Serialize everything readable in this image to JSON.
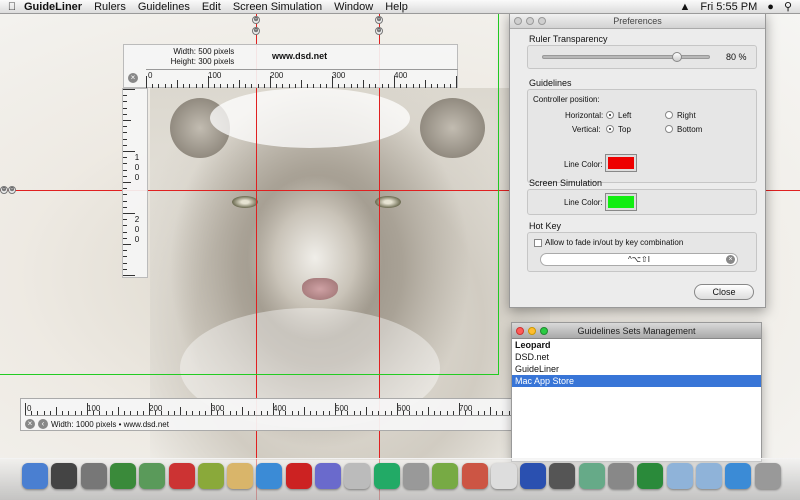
{
  "menubar": {
    "apple": "",
    "app_name": "GuideLiner",
    "items": [
      "Rulers",
      "Guidelines",
      "Edit",
      "Screen Simulation",
      "Window",
      "Help"
    ],
    "clock": "Fri 5:55 PM"
  },
  "top_ruler": {
    "width_label": "Width:",
    "width_value": "500 pixels",
    "height_label": "Height:",
    "height_value": "300 pixels",
    "site": "www.dsd.net",
    "labels": [
      "0",
      "100",
      "200",
      "300",
      "400"
    ]
  },
  "left_ruler": {
    "labels": [
      "1",
      "0",
      "0",
      "2",
      "0",
      "0"
    ]
  },
  "bottom_ruler": {
    "labels": [
      "0",
      "100",
      "200",
      "300",
      "400",
      "500",
      "600",
      "700",
      "800",
      "900"
    ],
    "marker": "843",
    "info": "Width: 1000 pixels • www.dsd.net"
  },
  "colors": {
    "guide_red": "#e02020",
    "guide_green": "#22cc22",
    "line_color_guidelines": "#ee0000",
    "line_color_screen": "#11ee11",
    "selection_blue": "#3875d7"
  },
  "preferences": {
    "title": "Preferences",
    "ruler_transparency_title": "Ruler Transparency",
    "ruler_transparency_value": "80 %",
    "ruler_transparency_fraction": 0.8,
    "guidelines_title": "Guidelines",
    "controller_position": "Controller position:",
    "horizontal_label": "Horizontal:",
    "vertical_label": "Vertical:",
    "left_option": "Left",
    "right_option": "Right",
    "top_option": "Top",
    "bottom_option": "Bottom",
    "line_color_label": "Line Color:",
    "screen_sim_title": "Screen Simulation",
    "screen_line_color_label": "Line Color:",
    "hotkey_title": "Hot Key",
    "fade_checkbox_label": "Allow to fade in/out by key combination",
    "hotkey_value": "^⌥⇧I",
    "close_label": "Close"
  },
  "sets_window": {
    "title": "Guidelines Sets Management",
    "items": [
      "Leopard",
      "DSD.net",
      "GuideLiner",
      "Mac App Store"
    ],
    "selected_index": 3
  },
  "dock": {
    "icons": [
      "finder-icon",
      "address-book-icon",
      "barcode-icon",
      "dashboard-icon",
      "money-icon",
      "no-entry-icon",
      "preview-icon",
      "face-icon",
      "safari-icon",
      "quill-icon",
      "network-icon",
      "clock-icon",
      "screen-icon",
      "microphone-icon",
      "pencil-icon",
      "book-icon",
      "textedit-icon",
      "p-app-icon",
      "photo-icon",
      "monitor-icon",
      "robot-icon",
      "globe-icon",
      "folder-icon",
      "folder-icon",
      "safari-small-icon",
      "trash-icon"
    ]
  }
}
